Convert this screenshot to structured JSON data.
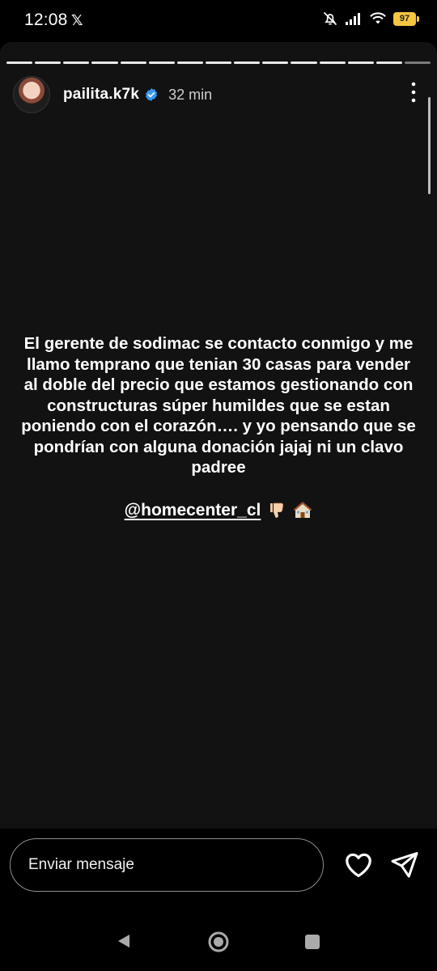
{
  "status_bar": {
    "time": "12:08",
    "x_icon": "x-logo-icon",
    "battery": "97",
    "icons": [
      "mute-icon",
      "signal-icon",
      "wifi-icon",
      "battery-icon"
    ]
  },
  "story": {
    "progress_segments_total": 15,
    "progress_segments_viewed": 14,
    "username": "pailita.k7k",
    "time_ago": "32 min",
    "text": "El gerente de sodimac se contacto conmigo y me llamo temprano que tenian 30 casas para vender al doble del precio que estamos gestionando con constructuras súper humildes que se estan poniendo con el corazón…. y yo pensando que se pondrían con alguna donación jajaj ni un clavo padree",
    "mention": "@homecenter_cl",
    "emojis": [
      "thumbs-down-icon",
      "house-icon"
    ]
  },
  "reply_bar": {
    "placeholder": "Enviar mensaje",
    "like_icon": "heart-icon",
    "send_icon": "send-icon"
  },
  "nav_bar": {
    "buttons": [
      "back-icon",
      "home-icon",
      "recents-icon"
    ]
  },
  "colors": {
    "background": "#121212",
    "text": "#ffffff",
    "battery": "#f4c542",
    "verified": "#3897f0"
  }
}
